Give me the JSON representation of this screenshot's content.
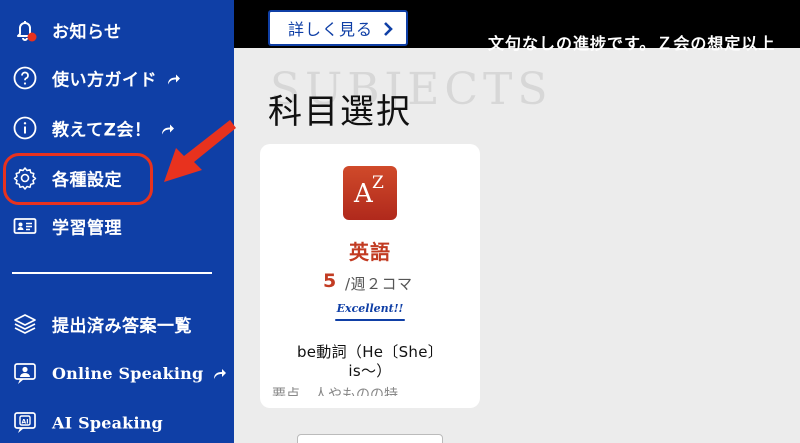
{
  "sidebar": {
    "items": [
      {
        "label": "お知らせ",
        "icon": "bell-icon"
      },
      {
        "label": "使い方ガイド",
        "icon": "question-circle-icon",
        "external": true
      },
      {
        "label": "教えてZ会！",
        "icon": "info-circle-icon",
        "external": true
      },
      {
        "label": "各種設定",
        "icon": "gear-icon"
      },
      {
        "label": "学習管理",
        "icon": "id-card-icon"
      },
      {
        "label": "提出済み答案一覧",
        "icon": "layers-icon"
      },
      {
        "label": "Online Speaking",
        "icon": "person-chat-icon",
        "external": true
      },
      {
        "label": "AI Speaking",
        "icon": "ai-chat-icon"
      }
    ]
  },
  "topbar": {
    "more_button": "詳しく見る",
    "ticker": "文句なしの進捗です。Ｚ会の想定以上"
  },
  "main": {
    "bg_text": "SUBJECTS",
    "title": "科目選択"
  },
  "card": {
    "subject": "英語",
    "count": "5",
    "per_week": "/週２コマ",
    "badge": "Excellent!!",
    "desc_line1": "be動詞（He〔She〕",
    "desc_line2": "is～）",
    "desc_faded": "要点　人やものの特…"
  },
  "colors": {
    "sidebar_bg": "#0f3fa6",
    "accent_red": "#c23b22",
    "highlight_red": "#e8321e",
    "notification_dot": "#e8321e"
  }
}
